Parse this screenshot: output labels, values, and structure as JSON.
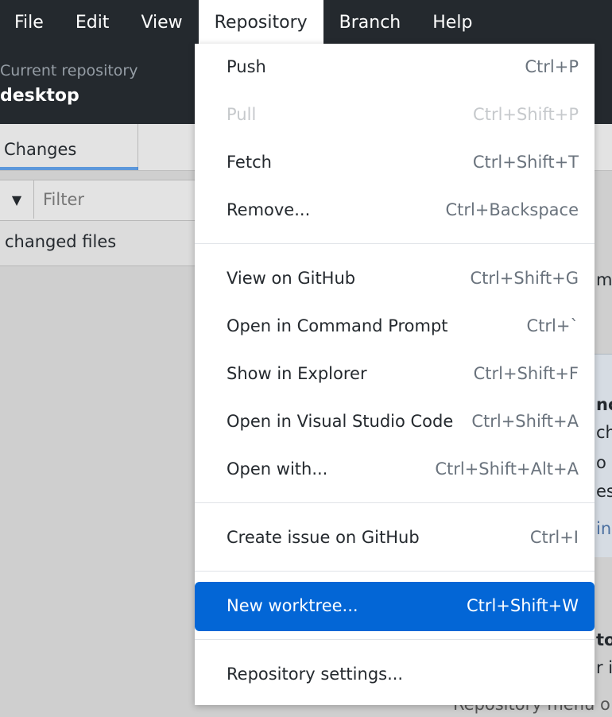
{
  "menubar": {
    "items": [
      {
        "label": "File"
      },
      {
        "label": "Edit"
      },
      {
        "label": "View"
      },
      {
        "label": "Repository"
      },
      {
        "label": "Branch"
      },
      {
        "label": "Help"
      }
    ]
  },
  "toolbar": {
    "repo_caption": "Current repository",
    "repo_name": "desktop"
  },
  "sidebar": {
    "tab_changes": "Changes",
    "filter_placeholder": "Filter",
    "changed_files": "changed files"
  },
  "background_peeks": {
    "p1": "mi",
    "p2": "nc",
    "p3": "ch",
    "p4": "o",
    "p5": "est",
    "p6": "in",
    "p7": "to",
    "p8": "r i",
    "p9": "Repository menu o"
  },
  "repository_menu": {
    "items": [
      {
        "label": "Push",
        "shortcut": "Ctrl+P"
      },
      {
        "label": "Pull",
        "shortcut": "Ctrl+Shift+P"
      },
      {
        "label": "Fetch",
        "shortcut": "Ctrl+Shift+T"
      },
      {
        "label": "Remove...",
        "shortcut": "Ctrl+Backspace"
      },
      {
        "label": "View on GitHub",
        "shortcut": "Ctrl+Shift+G"
      },
      {
        "label": "Open in Command Prompt",
        "shortcut": "Ctrl+`"
      },
      {
        "label": "Show in Explorer",
        "shortcut": "Ctrl+Shift+F"
      },
      {
        "label": "Open in Visual Studio Code",
        "shortcut": "Ctrl+Shift+A"
      },
      {
        "label": "Open with...",
        "shortcut": "Ctrl+Shift+Alt+A"
      },
      {
        "label": "Create issue on GitHub",
        "shortcut": "Ctrl+I"
      },
      {
        "label": "New worktree...",
        "shortcut": "Ctrl+Shift+W"
      },
      {
        "label": "Repository settings...",
        "shortcut": ""
      }
    ]
  },
  "colors": {
    "menubar_bg": "#24292e",
    "highlight": "#0366d6"
  }
}
